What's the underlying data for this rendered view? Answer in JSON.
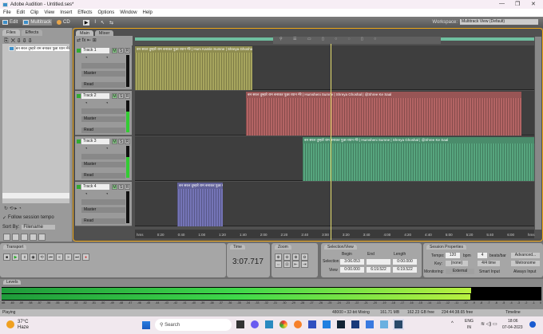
{
  "window": {
    "title": "Adobe Audition - Untitled.ses*",
    "controls": [
      "—",
      "❐",
      "✕"
    ]
  },
  "menu": [
    "File",
    "Edit",
    "Clip",
    "View",
    "Insert",
    "Effects",
    "Options",
    "Window",
    "Help"
  ],
  "toolbar": {
    "edit": "Edit",
    "multitrack": "Multitrack",
    "cd": "CD",
    "workspace_label": "Workspace:",
    "workspace_value": "Multitrack View (Default)"
  },
  "files_panel": {
    "tabs": [
      "Files",
      "Effects"
    ],
    "file": "बन सरल तुम्हारे राम बनाकर पुछा ध्यान मेरे",
    "follow_tempo": "Follow session tempo",
    "sort_by": "Sort By:",
    "sort_value": "Filename"
  },
  "main_panel": {
    "tabs": [
      "Main",
      "Mixer"
    ]
  },
  "tracks": [
    {
      "name": "Track 1",
      "output": "Master",
      "mode": "Read",
      "color": "#a7a55e",
      "clip": "बन सरल तुम्हारे राम बनाकर पुछा ध्यान मेरे | Hum Kamle Sumne | Shreya Ghoshal"
    },
    {
      "name": "Track 2",
      "output": "Master",
      "mode": "Read",
      "color": "#b36464",
      "clip": "बन सरल तुम्हारे राम बनाकर पुछा ध्यान मेरे | Humsheni Sumne | Shreya Ghoshal | @Shree Ke Saal"
    },
    {
      "name": "Track 3",
      "output": "Master",
      "mode": "Read",
      "color": "#57a57e",
      "clip": "बन सरल तुम्हारे राम बनाकर पुछा ध्यान मेरे | Humsheni Sumne | Shreya Ghoshal | @Shree Ke Saal"
    },
    {
      "name": "Track 4",
      "output": "Master",
      "mode": "Read",
      "color": "#7474b6",
      "clip": "बन सरल तुम्हारे राम बनाकर पुछा ध्यान मेरे"
    }
  ],
  "ruler": [
    "hms",
    "0:20",
    "0:40",
    "1:00",
    "1:20",
    "1:40",
    "2:00",
    "2:20",
    "2:40",
    "3:00",
    "3:20",
    "3:40",
    "4:00",
    "4:20",
    "4:40",
    "5:00",
    "5:20",
    "5:40",
    "6:00",
    "hms"
  ],
  "transport": {
    "title": "Transport"
  },
  "time": {
    "title": "Time",
    "value": "3:07.717"
  },
  "zoom": {
    "title": "Zoom"
  },
  "selection": {
    "title": "Selection/View",
    "begin": "Begin",
    "end": "End",
    "length": "Length",
    "selection_label": "Selection",
    "view_label": "View",
    "sel_begin": "3:06.053",
    "sel_end": "",
    "sel_length": "0:00.000",
    "view_begin": "0:00.000",
    "view_end": "6:19.522",
    "view_length": "6:19.522"
  },
  "session": {
    "title": "Session Properties",
    "tempo_label": "Tempo:",
    "tempo": "120",
    "bpm": "bpm",
    "beats": "4",
    "beats_label": "beats/bar",
    "advanced": "Advanced...",
    "key_label": "Key:",
    "key": "(none)",
    "time_sig": "4/4 time",
    "metronome": "Metronome",
    "monitoring_label": "Monitoring:",
    "monitoring": "External",
    "smart_input": "Smart Input",
    "always_input": "Always Input"
  },
  "levels": {
    "title": "Levels",
    "scale": [
      "dB",
      "-60",
      "-59",
      "-58",
      "-57",
      "-56",
      "-55",
      "-54",
      "-53",
      "-52",
      "-51",
      "-50",
      "-49",
      "-48",
      "-47",
      "-46",
      "-45",
      "-44",
      "-43",
      "-42",
      "-41",
      "-40",
      "-39",
      "-38",
      "-37",
      "-36",
      "-35",
      "-34",
      "-33",
      "-32",
      "-31",
      "-30",
      "-29",
      "-28",
      "-27",
      "-26",
      "-25",
      "-24",
      "-23",
      "-22",
      "-21",
      "-20",
      "-19",
      "-18",
      "-17",
      "-16",
      "-15",
      "-14",
      "-13",
      "-12",
      "-11",
      "-10",
      "-9",
      "-8",
      "-7",
      "-6",
      "-5",
      "-4",
      "-3",
      "-2",
      "-1",
      "0"
    ],
    "level_fraction": 0.87
  },
  "status": {
    "state": "Playing",
    "format": "48000 • 32-bit Mixing",
    "mem": "161.71 MB",
    "free": "162.23 GB free",
    "time_free": "234:44:38.65 free",
    "mode": "Timeline"
  },
  "taskbar": {
    "temp": "37°C",
    "weather": "Haze",
    "search": "Search",
    "lang1": "ENG",
    "lang2": "IN",
    "time": "18:06",
    "date": "07-04-2023"
  }
}
